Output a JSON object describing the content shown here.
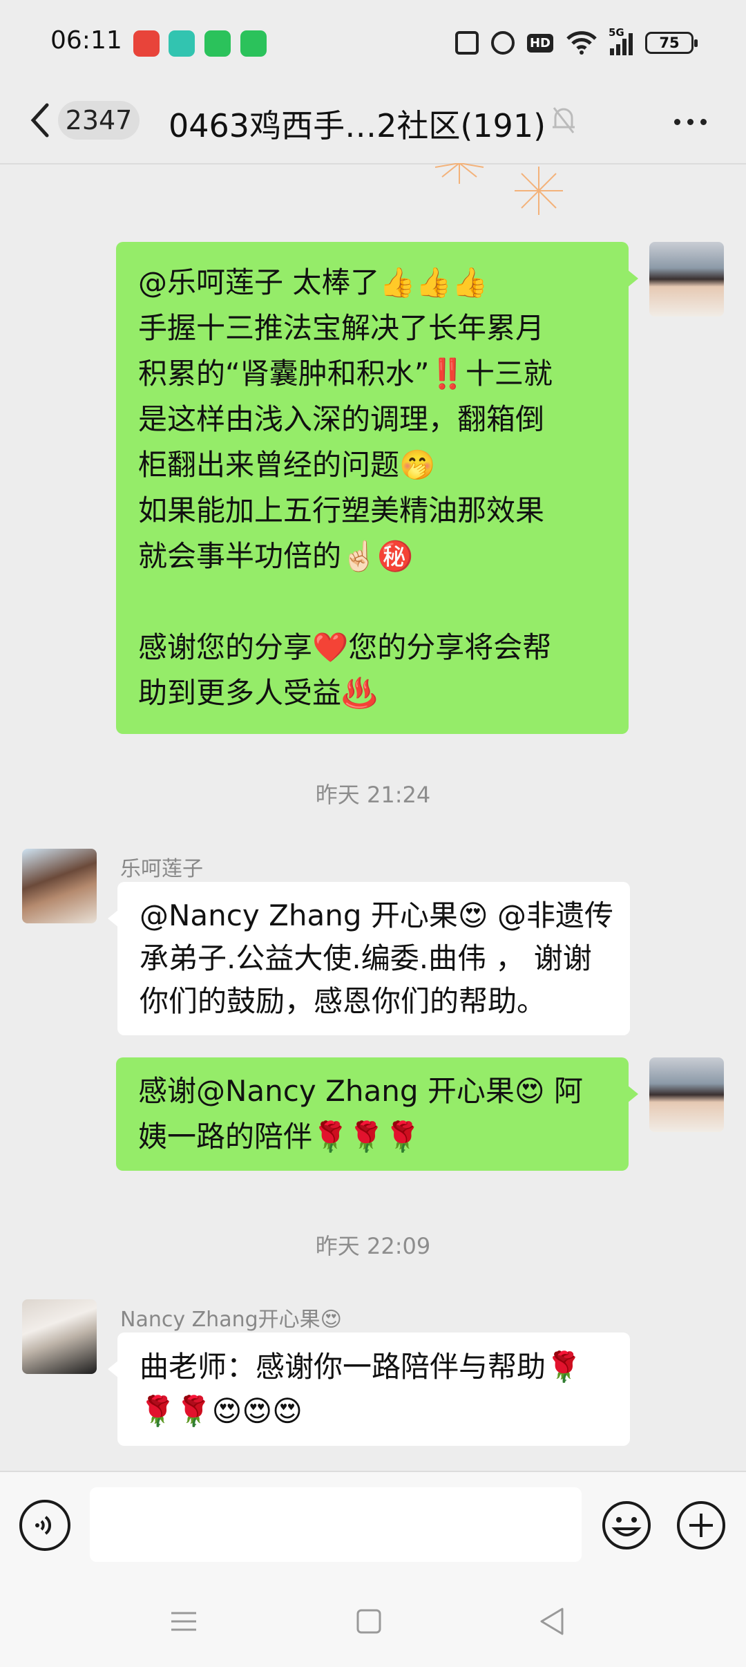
{
  "status_bar": {
    "time": "06:11",
    "network": "5G",
    "battery": "75",
    "hd_label": "HD"
  },
  "header": {
    "unread_count": "2347",
    "title": "0463鸡西手…2社区(191)"
  },
  "messages": [
    {
      "direction": "out",
      "lines": [
        "@乐呵莲子 太棒了👍👍👍",
        "手握十三推法宝解决了长年累月",
        "积累的“肾囊肿和积水”‼️十三就",
        "是这样由浅入深的调理，翻箱倒",
        "柜翻出来曾经的问题🤭",
        "如果能加上五行塑美精油那效果",
        "就会事半功倍的☝🏻㊙️",
        "",
        "感谢您的分享❤️您的分享将会帮",
        "助到更多人受益♨️"
      ]
    },
    {
      "timestamp": "昨天 21:24"
    },
    {
      "direction": "in",
      "sender": "乐呵莲子",
      "lines": [
        "@Nancy Zhang 开心果😍 @非遗传",
        "承弟子.公益大使.编委.曲伟 ， 谢谢",
        "你们的鼓励，感恩你们的帮助。"
      ]
    },
    {
      "direction": "out",
      "lines": [
        "感谢@Nancy Zhang 开心果😍  阿",
        "姨一路的陪伴🌹🌹🌹"
      ]
    },
    {
      "timestamp": "昨天 22:09"
    },
    {
      "direction": "in",
      "sender": "Nancy Zhang开心果😍",
      "lines": [
        "曲老师：感谢你一路陪伴与帮助🌹",
        "🌹🌹😍😍😍"
      ]
    }
  ],
  "input": {
    "value": ""
  },
  "colors": {
    "outgoing_bubble": "#95ec69",
    "incoming_bubble": "#ffffff",
    "background": "#ededed"
  }
}
